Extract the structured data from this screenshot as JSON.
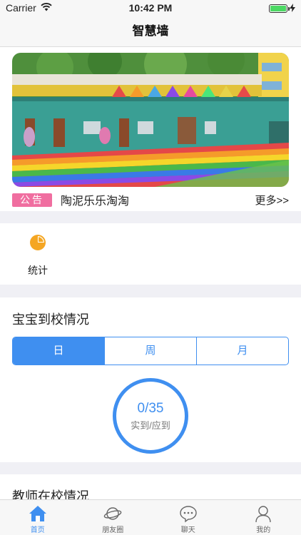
{
  "status_bar": {
    "carrier": "Carrier",
    "time": "10:42 PM"
  },
  "nav": {
    "title": "智慧墙"
  },
  "notice": {
    "tag": "公告",
    "text": "陶泥乐乐淘淘",
    "more": "更多>>"
  },
  "stats": {
    "label": "统计"
  },
  "attendance": {
    "title": "宝宝到校情况",
    "segments": [
      "日",
      "周",
      "月"
    ],
    "selected": "日",
    "ring_value": "0/35",
    "ring_caption": "实到/应到"
  },
  "teachers": {
    "title": "教师在校情况"
  },
  "tabs": [
    {
      "label": "首页",
      "icon": "home-icon",
      "active": true
    },
    {
      "label": "朋友圈",
      "icon": "planet-icon",
      "active": false
    },
    {
      "label": "聊天",
      "icon": "chat-bubble-icon",
      "active": false
    },
    {
      "label": "我的",
      "icon": "person-icon",
      "active": false
    }
  ],
  "colors": {
    "accent": "#3f8ff0",
    "notice_tag": "#f06ea0",
    "stats_icon": "#f5a623",
    "battery": "#4cd964"
  }
}
